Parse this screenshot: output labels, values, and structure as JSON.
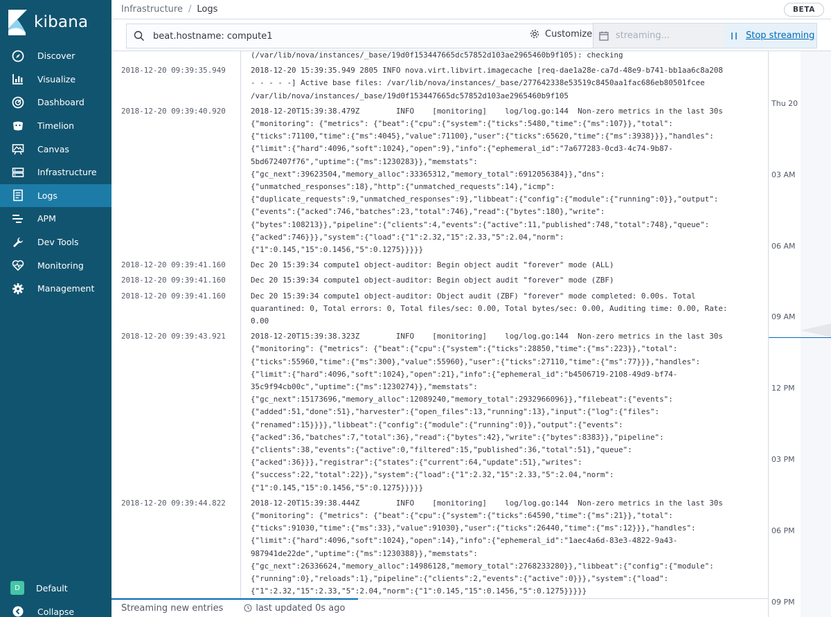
{
  "app": {
    "name": "kibana"
  },
  "nav": [
    {
      "label": "Discover",
      "icon": "compass-icon"
    },
    {
      "label": "Visualize",
      "icon": "bar-chart-icon"
    },
    {
      "label": "Dashboard",
      "icon": "dashboard-gauge-icon"
    },
    {
      "label": "Timelion",
      "icon": "timelion-icon"
    },
    {
      "label": "Canvas",
      "icon": "canvas-icon"
    },
    {
      "label": "Infrastructure",
      "icon": "infrastructure-icon"
    },
    {
      "label": "Logs",
      "icon": "logs-icon",
      "active": true
    },
    {
      "label": "APM",
      "icon": "apm-icon"
    },
    {
      "label": "Dev Tools",
      "icon": "wrench-icon"
    },
    {
      "label": "Monitoring",
      "icon": "heartbeat-icon"
    },
    {
      "label": "Management",
      "icon": "gear-icon"
    }
  ],
  "space": {
    "initial": "D",
    "label": "Default"
  },
  "collapse_label": "Collapse",
  "breadcrumbs": [
    "Infrastructure",
    "Logs"
  ],
  "beta_badge": "BETA",
  "search": {
    "value": "beat.hostname: compute1"
  },
  "customize_label": "Customize",
  "streaming": {
    "placeholder": "streaming...",
    "stop_label": "Stop streaming"
  },
  "log_rows": [
    {
      "ts": "",
      "lines": [
        "(/var/lib/nova/instances/_base/19d0f153447665dc57852d103ae2965460b9f105): checking"
      ]
    },
    {
      "ts": "2018-12-20 09:39:35.949",
      "lines": [
        "2018-12-20 15:39:35.949 2805 INFO nova.virt.libvirt.imagecache [req-dae1a28e-ca7d-48e9-b741-bb1aa6c8a208",
        "- - - - -] Active base files: /var/lib/nova/instances/_base/277642338e53519c8450aa1fac686eb80501fcee",
        "/var/lib/nova/instances/_base/19d0f153447665dc57852d103ae2965460b9f105"
      ]
    },
    {
      "ts": "2018-12-20 09:39:40.920",
      "lines": [
        "2018-12-20T15:39:38.479Z        INFO    [monitoring]    log/log.go:144  Non-zero metrics in the last 30s",
        "{\"monitoring\": {\"metrics\": {\"beat\":{\"cpu\":{\"system\":{\"ticks\":5480,\"time\":{\"ms\":107}},\"total\":",
        "{\"ticks\":71100,\"time\":{\"ms\":4045},\"value\":71100},\"user\":{\"ticks\":65620,\"time\":{\"ms\":3938}}},\"handles\":",
        "{\"limit\":{\"hard\":4096,\"soft\":1024},\"open\":9},\"info\":{\"ephemeral_id\":\"7a677283-0cd3-4c74-9b87-",
        "5bd672407f76\",\"uptime\":{\"ms\":1230283}},\"memstats\":",
        "{\"gc_next\":39623504,\"memory_alloc\":33365312,\"memory_total\":6912056384}},\"dns\":",
        "{\"unmatched_responses\":18},\"http\":{\"unmatched_requests\":14},\"icmp\":",
        "{\"duplicate_requests\":9,\"unmatched_responses\":9},\"libbeat\":{\"config\":{\"module\":{\"running\":0}},\"output\":",
        "{\"events\":{\"acked\":746,\"batches\":23,\"total\":746},\"read\":{\"bytes\":180},\"write\":",
        "{\"bytes\":108213}},\"pipeline\":{\"clients\":4,\"events\":{\"active\":11,\"published\":748,\"total\":748},\"queue\":",
        "{\"acked\":746}}},\"system\":{\"load\":{\"1\":2.32,\"15\":2.33,\"5\":2.04,\"norm\":",
        "{\"1\":0.145,\"15\":0.1456,\"5\":0.1275}}}}}"
      ]
    },
    {
      "ts": "2018-12-20 09:39:41.160",
      "lines": [
        "Dec 20 15:39:34 compute1 object-auditor: Begin object audit \"forever\" mode (ALL)"
      ]
    },
    {
      "ts": "2018-12-20 09:39:41.160",
      "lines": [
        "Dec 20 15:39:34 compute1 object-auditor: Begin object audit \"forever\" mode (ZBF)"
      ]
    },
    {
      "ts": "2018-12-20 09:39:41.160",
      "lines": [
        "Dec 20 15:39:34 compute1 object-auditor: Object audit (ZBF) \"forever\" mode completed: 0.00s. Total",
        "quarantined: 0, Total errors: 0, Total files/sec: 0.00, Total bytes/sec: 0.00, Auditing time: 0.00, Rate:",
        "0.00"
      ]
    },
    {
      "ts": "2018-12-20 09:39:43.921",
      "lines": [
        "2018-12-20T15:39:38.323Z        INFO    [monitoring]    log/log.go:144  Non-zero metrics in the last 30s",
        "{\"monitoring\": {\"metrics\": {\"beat\":{\"cpu\":{\"system\":{\"ticks\":28850,\"time\":{\"ms\":223}},\"total\":",
        "{\"ticks\":55960,\"time\":{\"ms\":300},\"value\":55960},\"user\":{\"ticks\":27110,\"time\":{\"ms\":77}}},\"handles\":",
        "{\"limit\":{\"hard\":4096,\"soft\":1024},\"open\":21},\"info\":{\"ephemeral_id\":\"b4506719-2108-49d9-bf74-",
        "35c9f94cb00c\",\"uptime\":{\"ms\":1230274}},\"memstats\":",
        "{\"gc_next\":15173696,\"memory_alloc\":12089240,\"memory_total\":2932966096}},\"filebeat\":{\"events\":",
        "{\"added\":51,\"done\":51},\"harvester\":{\"open_files\":13,\"running\":13},\"input\":{\"log\":{\"files\":",
        "{\"renamed\":15}}}},\"libbeat\":{\"config\":{\"module\":{\"running\":0}},\"output\":{\"events\":",
        "{\"acked\":36,\"batches\":7,\"total\":36},\"read\":{\"bytes\":42},\"write\":{\"bytes\":8383}},\"pipeline\":",
        "{\"clients\":38,\"events\":{\"active\":0,\"filtered\":15,\"published\":36,\"total\":51},\"queue\":",
        "{\"acked\":36}}},\"registrar\":{\"states\":{\"current\":64,\"update\":51},\"writes\":",
        "{\"success\":22,\"total\":22}},\"system\":{\"load\":{\"1\":2.32,\"15\":2.33,\"5\":2.04,\"norm\":",
        "{\"1\":0.145,\"15\":0.1456,\"5\":0.1275}}}}}"
      ]
    },
    {
      "ts": "2018-12-20 09:39:44.822",
      "lines": [
        "2018-12-20T15:39:38.444Z        INFO    [monitoring]    log/log.go:144  Non-zero metrics in the last 30s",
        "{\"monitoring\": {\"metrics\": {\"beat\":{\"cpu\":{\"system\":{\"ticks\":64590,\"time\":{\"ms\":21}},\"total\":",
        "{\"ticks\":91030,\"time\":{\"ms\":33},\"value\":91030},\"user\":{\"ticks\":26440,\"time\":{\"ms\":12}}},\"handles\":",
        "{\"limit\":{\"hard\":4096,\"soft\":1024},\"open\":14},\"info\":{\"ephemeral_id\":\"1aec4a6d-83e3-4822-9a43-",
        "987941de22de\",\"uptime\":{\"ms\":1230388}},\"memstats\":",
        "{\"gc_next\":26336624,\"memory_alloc\":14986128,\"memory_total\":2768233280}},\"libbeat\":{\"config\":{\"module\":",
        "{\"running\":0},\"reloads\":1},\"pipeline\":{\"clients\":2,\"events\":{\"active\":0}}},\"system\":{\"load\":",
        "{\"1\":2.32,\"15\":2.33,\"5\":2.04,\"norm\":{\"1\":0.145,\"15\":0.1456,\"5\":0.1275}}}}}"
      ]
    }
  ],
  "minimap_ticks": [
    "Thu 20",
    "03 AM",
    "06 AM",
    "09 AM",
    "12 PM",
    "03 PM",
    "06 PM",
    "09 PM"
  ],
  "footer": {
    "status": "Streaming new entries",
    "updated": "last updated 0s ago"
  },
  "colors": {
    "sidebar": "#11546f",
    "active": "#1c7ca7",
    "accent": "#006bb4"
  }
}
